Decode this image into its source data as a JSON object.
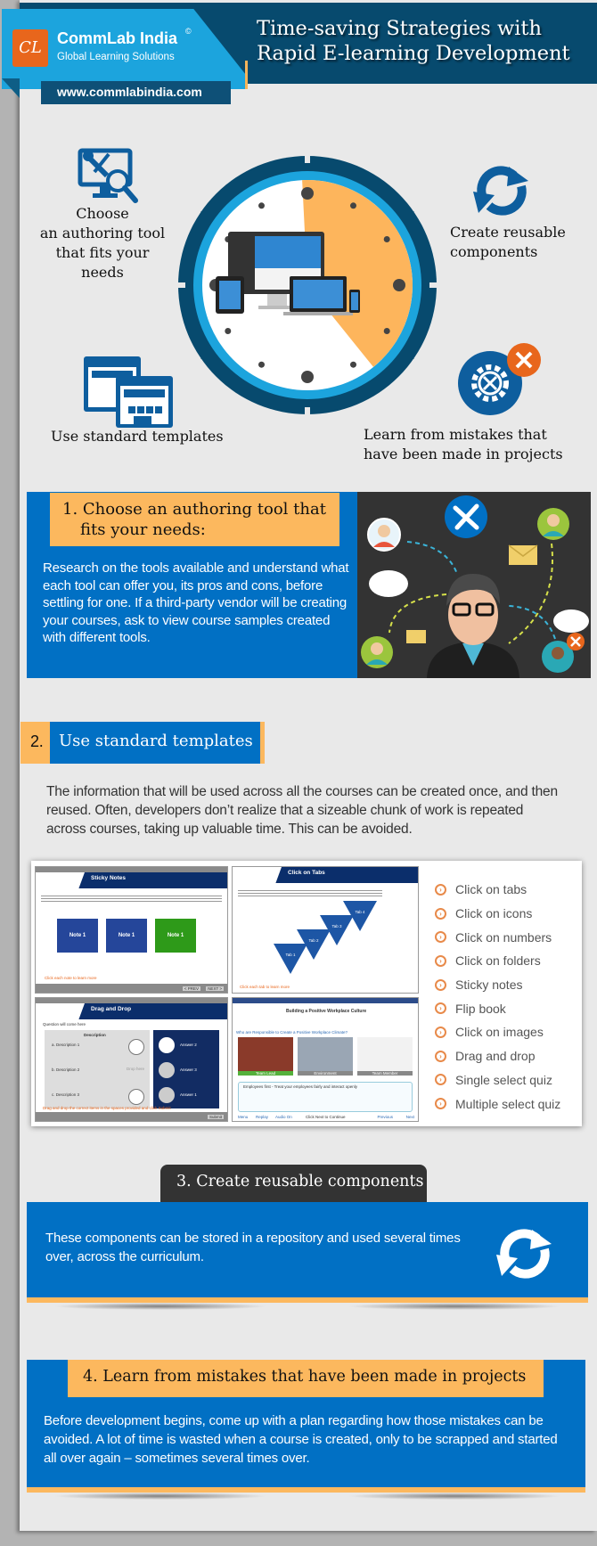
{
  "header": {
    "brand_mark": "CL",
    "brand_name": "CommLab India",
    "brand_copyright": "©",
    "brand_tagline": "Global Learning Solutions",
    "website": "www.commlabindia.com",
    "title_line1": "Time-saving Strategies with",
    "title_line2": "Rapid E-learning Development"
  },
  "overview": {
    "items": [
      {
        "label_lines": [
          "Choose",
          "an authoring tool",
          "that fits your needs"
        ],
        "icon": "monitor-tools-search-icon"
      },
      {
        "label_lines": [
          "Create reusable",
          "components"
        ],
        "icon": "sync-arrows-icon"
      },
      {
        "label_lines": [
          "Use standard templates"
        ],
        "icon": "templates-icon"
      },
      {
        "label_lines": [
          "Learn from mistakes that",
          "have been made in projects"
        ],
        "icon": "gear-error-icon"
      }
    ],
    "clock": {
      "highlight_fraction": 0.4,
      "center_icon": "responsive-devices-icon"
    }
  },
  "colors": {
    "brand_blue": "#0170c4",
    "dark_navy": "#074a6e",
    "light_blue": "#1ca4dd",
    "accent_orange": "#fcb85e",
    "logo_orange": "#e8661c",
    "panel_gray": "#e9e9e9"
  },
  "sections": {
    "s1": {
      "title": "1. Choose an authoring tool that fits your needs:",
      "title_line1": "1. Choose an authoring tool that",
      "title_line2": "fits your needs:",
      "body": "Research on the tools available and understand what each tool can offer you, its pros and cons, before settling for one. If a third-party vendor will be creating your courses, ask to view course samples created with different tools."
    },
    "s2": {
      "number": "2.",
      "title": "Use standard templates",
      "body": "The information that will be used across all the courses can be created once, and then reused. Often, developers don’t realize that a sizeable chunk of work is repeated across courses, taking up valuable time. This can be avoided.",
      "screens": [
        {
          "title": "Sticky Notes",
          "notes": [
            "Note 1",
            "Note 1",
            "Note 1"
          ],
          "hint": "Click each note to learn more",
          "buttons": [
            "< PREV",
            "NEXT >"
          ]
        },
        {
          "title": "Click on Tabs",
          "tabs": [
            "Tab 1",
            "Tab 2",
            "Tab 3",
            "Tab 4"
          ],
          "hint": "Click each tab to learn more"
        },
        {
          "title": "Drag and Drop",
          "question": "Question will come here",
          "column_header": "Description",
          "descriptions": [
            "a. Description 1",
            "b. Description 2",
            "c. Description 3"
          ],
          "answers": [
            "Answer 2",
            "Answer 3",
            "Answer 1"
          ],
          "drop_here": "Drop here",
          "hint": "Drag and drop the correct items in the spaces provided and click Submit",
          "button": "Submit"
        },
        {
          "title": "Building a Positive Workplace Culture",
          "question": "Who are Responsible to Create a Positive Workplace Climate?",
          "cards": [
            "Team Lead",
            "Environment",
            "Team Member"
          ],
          "note": "Employees first - Treat your employees fairly and interact openly",
          "footer_left": [
            "Menu",
            "Replay",
            "Audio On"
          ],
          "footer_center": "Click Next to Continue",
          "footer_right": [
            "Previous",
            "Next"
          ]
        }
      ],
      "features": [
        "Click on tabs",
        "Click on icons",
        "Click on numbers",
        "Click on folders",
        "Sticky notes",
        "Flip book",
        "Click on images",
        "Drag and drop",
        "Single select quiz",
        "Multiple select quiz"
      ]
    },
    "s3": {
      "title": "3.  Create reusable components",
      "body": "These components can be stored in a repository and used several times over, across the curriculum."
    },
    "s4": {
      "title": "4. Learn from mistakes that have been made in projects",
      "body": "Before development begins, come up with a plan regarding how those mistakes can be avoided. A lot of time is wasted when a course is created, only to be scrapped and started all over again – sometimes several times over."
    }
  }
}
